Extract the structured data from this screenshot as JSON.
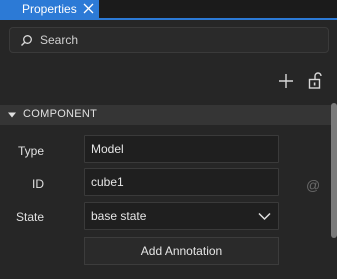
{
  "tab": {
    "label": "Properties",
    "accent_color": "#2c7ad6"
  },
  "search": {
    "placeholder": "Search",
    "value": ""
  },
  "toolbar": {
    "icons": [
      "plus-icon",
      "lock-open-icon"
    ]
  },
  "section": {
    "title": "COMPONENT",
    "expanded": true
  },
  "properties": {
    "type": {
      "label": "Type",
      "value": "Model"
    },
    "id": {
      "label": "ID",
      "value": "cube1",
      "binding_icon": "@"
    },
    "state": {
      "label": "State",
      "value": "base state"
    }
  },
  "add_annotation_label": "Add Annotation"
}
